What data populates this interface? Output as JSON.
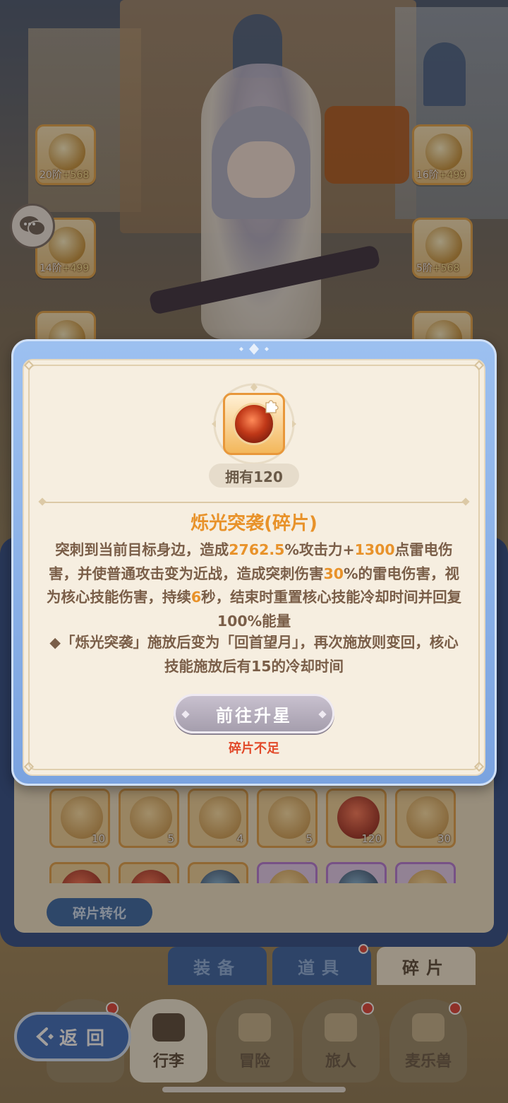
{
  "equipment": {
    "slots": [
      {
        "tier": "20阶",
        "bonus": "+568"
      },
      {
        "tier": "14阶",
        "bonus": "+499"
      },
      {
        "tier": "16阶",
        "bonus": "+499"
      },
      {
        "tier": "5阶",
        "bonus": "+568"
      }
    ]
  },
  "dialog": {
    "owned_label": "拥有120",
    "title": "烁光突袭(碎片)",
    "desc": {
      "p1": "突刺到当前目标身边，造成",
      "v1": "2762.5",
      "p2": "%攻击力+",
      "v2": "1300",
      "p3": "点雷电伤害，并使普通攻击变为近战，造成突刺伤害",
      "v3": "30",
      "p4": "%的雷电伤害，视为核心技能伤害，持续",
      "v4": "6",
      "p5": "秒，结束时重置核心技能冷却时间并回复100%能量"
    },
    "desc2": "◆「烁光突袭」施放后变为「回首望月」，再次施放则变回，核心技能施放后有15的冷却时间",
    "star_button": "前往升星",
    "insufficient": "碎片不足"
  },
  "fragments": {
    "row1_counts": [
      "10",
      "5",
      "4",
      "5",
      "120",
      "30"
    ],
    "convert_button": "碎片转化"
  },
  "tabs": {
    "items": [
      "装备",
      "道具",
      "碎片"
    ],
    "active": "碎片"
  },
  "nav": {
    "items": [
      "行李",
      "冒险",
      "旅人",
      "麦乐兽"
    ],
    "active": "行李"
  },
  "back_button": "返回",
  "colors": {
    "accent_orange": "#e8922a",
    "warning_red": "#e24a2a",
    "dialog_blue": "#7aa3e0",
    "text_brown": "#7a5e48"
  }
}
